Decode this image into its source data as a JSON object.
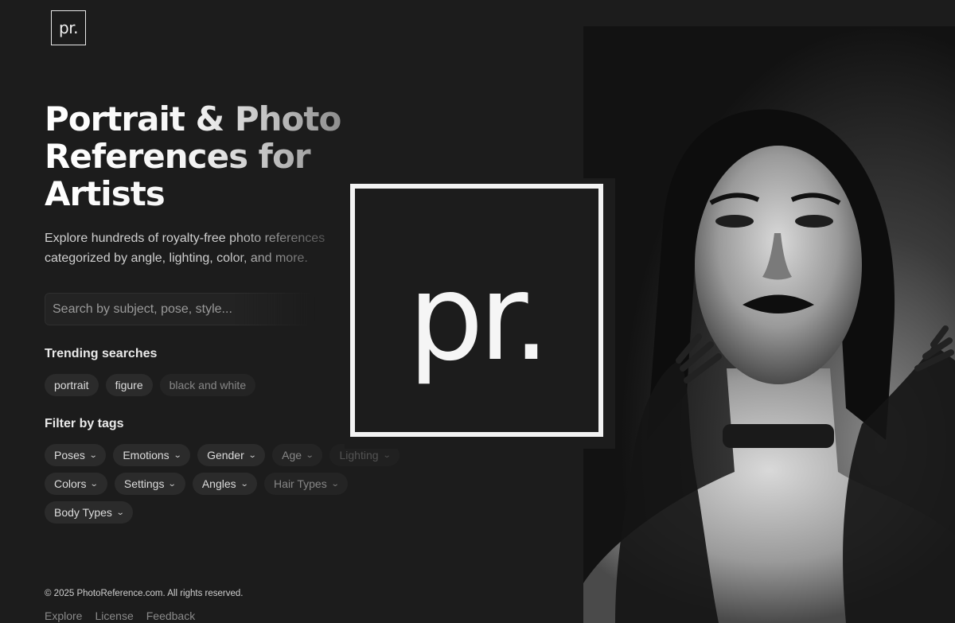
{
  "brand": {
    "logo_text": "pr."
  },
  "hero": {
    "title_line1": "Portrait & Photo",
    "title_line2": "References for",
    "title_line3": "Artists",
    "subtitle_line1": "Explore hundreds of royalty-free photo references",
    "subtitle_line2": "categorized by angle, lighting, color, and more."
  },
  "search": {
    "placeholder": "Search by subject, pose, style..."
  },
  "trending": {
    "heading": "Trending searches",
    "items": [
      "portrait",
      "figure",
      "black and white"
    ]
  },
  "filters": {
    "heading": "Filter by tags",
    "row1": [
      "Poses",
      "Emotions",
      "Gender",
      "Age",
      "Lighting"
    ],
    "row2": [
      "Colors",
      "Settings",
      "Angles",
      "Hair Types"
    ],
    "row3": [
      "Body Types"
    ]
  },
  "footer": {
    "copyright": "© 2025 PhotoReference.com. All rights reserved.",
    "links": [
      "Explore",
      "License",
      "Feedback"
    ]
  },
  "overlay_logo": {
    "text": "pr."
  },
  "colors": {
    "background": "#1c1c1c",
    "chip": "#2b2b2b",
    "text": "#eaeaea"
  }
}
